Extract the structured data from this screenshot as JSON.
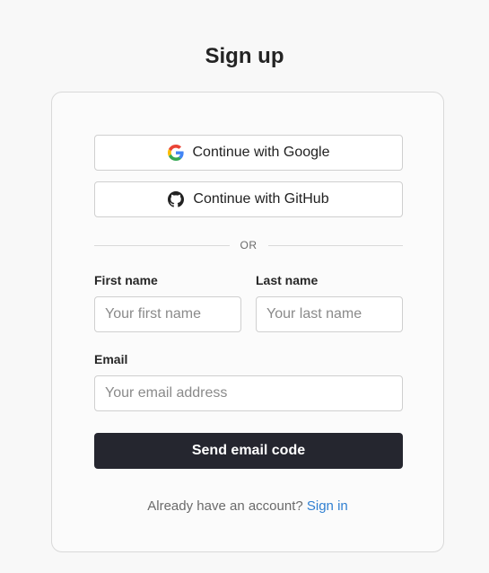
{
  "page": {
    "title": "Sign up"
  },
  "oauth": {
    "google_label": "Continue with Google",
    "github_label": "Continue with GitHub"
  },
  "divider": {
    "text": "OR"
  },
  "form": {
    "first_name_label": "First name",
    "first_name_placeholder": "Your first name",
    "first_name_value": "",
    "last_name_label": "Last name",
    "last_name_placeholder": "Your last name",
    "last_name_value": "",
    "email_label": "Email",
    "email_placeholder": "Your email address",
    "email_value": "",
    "submit_label": "Send email code"
  },
  "footer": {
    "prompt": "Already have an account?",
    "link_label": "Sign in"
  },
  "colors": {
    "primary_button": "#25262f",
    "link": "#2f7fd1",
    "background": "#f8f8f8"
  },
  "icons": {
    "google": "google-icon",
    "github": "github-icon"
  }
}
